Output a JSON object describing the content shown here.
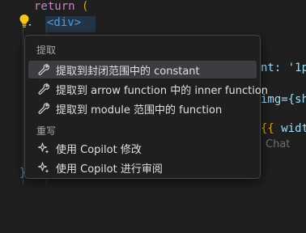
{
  "editor": {
    "line1": {
      "keyword": "return",
      "paren": "("
    },
    "line2": {
      "tag": "<div>"
    },
    "line4": {
      "text_fragment": "nt: '1p"
    },
    "line6": {
      "text_fragment": "img={sh"
    },
    "line8": {
      "brace": "{{",
      "text_fragment": " widt"
    },
    "line9": {
      "ghost_text": "Chat"
    },
    "closing_bracket": "}"
  },
  "quick_fix_menu": {
    "sections": [
      {
        "header": "提取",
        "items": [
          {
            "label": "提取到封闭范围中的 constant",
            "icon": "wrench-icon",
            "active": true
          },
          {
            "label": "提取到 arrow function 中的 inner function",
            "icon": "wrench-icon",
            "active": false
          },
          {
            "label": "提取到 module 范围中的 function",
            "icon": "wrench-icon",
            "active": false
          }
        ]
      },
      {
        "header": "重写",
        "items": [
          {
            "label": "使用 Copilot 修改",
            "icon": "sparkle-icon",
            "active": false
          },
          {
            "label": "使用 Copilot 进行审阅",
            "icon": "sparkle-icon",
            "active": false
          }
        ]
      }
    ]
  },
  "colors": {
    "editor_bg": "#1f1f1f",
    "menu_bg": "#1f1f1f",
    "menu_border": "#454545",
    "active_item_bg": "#3b3d41",
    "keyword": "#c586c0",
    "tag": "#569cd6",
    "lightbulb": "#f5c518"
  }
}
